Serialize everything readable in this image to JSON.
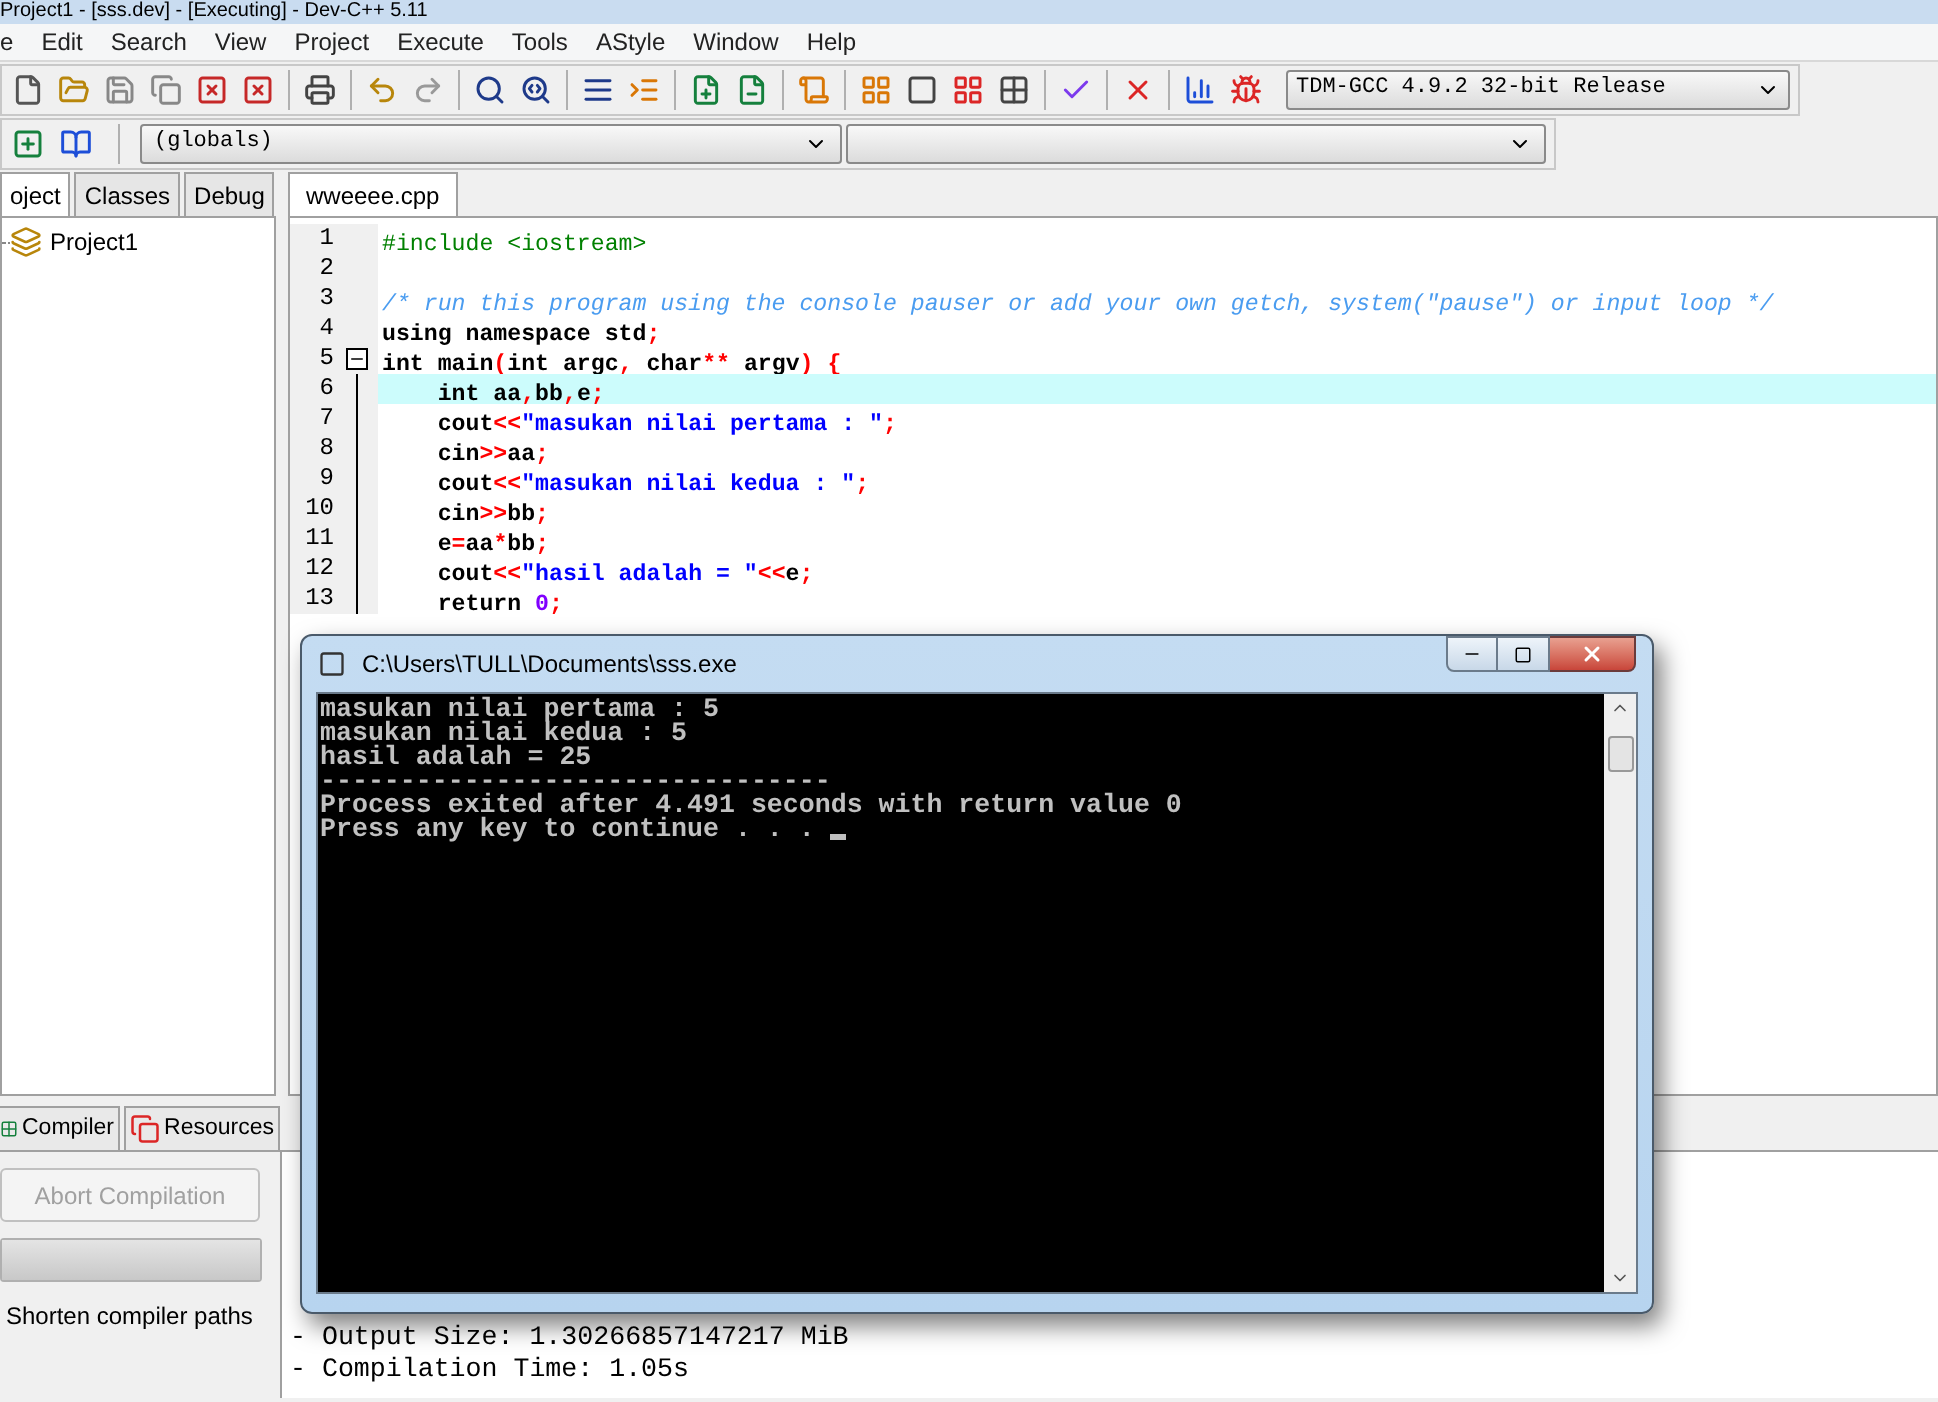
{
  "window": {
    "title": "Project1 - [sss.dev] - [Executing] - Dev-C++ 5.11"
  },
  "menu": [
    "e",
    "Edit",
    "Search",
    "View",
    "Project",
    "Execute",
    "Tools",
    "AStyle",
    "Window",
    "Help"
  ],
  "toolbar": {
    "compiler": "TDM-GCC 4.9.2 32-bit Release",
    "scope": "(globals)"
  },
  "left_tabs": [
    {
      "label": "oject",
      "selected": true
    },
    {
      "label": "Classes",
      "selected": false
    },
    {
      "label": "Debug",
      "selected": false
    }
  ],
  "project_tree": [
    {
      "label": "Project1"
    }
  ],
  "editor_tabs": [
    {
      "label": "wweeee.cpp",
      "selected": true
    }
  ],
  "code_lines": [
    {
      "number": "1",
      "current": false,
      "fold": false,
      "tokens": [
        {
          "kind": "preprocessor",
          "text": "#include <iostream>"
        }
      ]
    },
    {
      "number": "2",
      "current": false,
      "fold": false
    },
    {
      "number": "3",
      "current": false,
      "fold": false,
      "tokens": [
        {
          "kind": "comment",
          "text": "/* run this program using the console pauser or add your own getch, system(\"pause\") or input loop */"
        }
      ]
    },
    {
      "number": "4",
      "current": false,
      "fold": false,
      "tokens": [
        {
          "kind": "plain",
          "text": "using namespace std"
        },
        {
          "kind": "symbol",
          "text": ";"
        }
      ]
    },
    {
      "number": "5",
      "current": false,
      "fold": true,
      "tokens": [
        {
          "kind": "plain",
          "text": "int main"
        },
        {
          "kind": "symbol",
          "text": "("
        },
        {
          "kind": "plain",
          "text": "int argc"
        },
        {
          "kind": "symbol",
          "text": ","
        },
        {
          "kind": "plain",
          "text": " char"
        },
        {
          "kind": "symbol",
          "text": "**"
        },
        {
          "kind": "plain",
          "text": " argv"
        },
        {
          "kind": "symbol",
          "text": ") {"
        }
      ]
    },
    {
      "number": "6",
      "current": true,
      "fold": false,
      "tokens": [
        {
          "kind": "plain",
          "text": "    int aa"
        },
        {
          "kind": "symbol",
          "text": ","
        },
        {
          "kind": "plain",
          "text": "bb"
        },
        {
          "kind": "symbol",
          "text": ","
        },
        {
          "kind": "plain",
          "text": "e"
        },
        {
          "kind": "symbol",
          "text": ";"
        }
      ]
    },
    {
      "number": "7",
      "current": false,
      "fold": false,
      "tokens": [
        {
          "kind": "plain",
          "text": "    cout"
        },
        {
          "kind": "symbol",
          "text": "<<"
        },
        {
          "kind": "string",
          "text": "\"masukan nilai pertama : \""
        },
        {
          "kind": "symbol",
          "text": ";"
        }
      ]
    },
    {
      "number": "8",
      "current": false,
      "fold": false,
      "tokens": [
        {
          "kind": "plain",
          "text": "    cin"
        },
        {
          "kind": "symbol",
          "text": ">>"
        },
        {
          "kind": "plain",
          "text": "aa"
        },
        {
          "kind": "symbol",
          "text": ";"
        }
      ]
    },
    {
      "number": "9",
      "current": false,
      "fold": false,
      "tokens": [
        {
          "kind": "plain",
          "text": "    cout"
        },
        {
          "kind": "symbol",
          "text": "<<"
        },
        {
          "kind": "string",
          "text": "\"masukan nilai kedua : \""
        },
        {
          "kind": "symbol",
          "text": ";"
        }
      ]
    },
    {
      "number": "10",
      "current": false,
      "fold": false,
      "tokens": [
        {
          "kind": "plain",
          "text": "    cin"
        },
        {
          "kind": "symbol",
          "text": ">>"
        },
        {
          "kind": "plain",
          "text": "bb"
        },
        {
          "kind": "symbol",
          "text": ";"
        }
      ]
    },
    {
      "number": "11",
      "current": false,
      "fold": false,
      "tokens": [
        {
          "kind": "plain",
          "text": "    e"
        },
        {
          "kind": "symbol",
          "text": "="
        },
        {
          "kind": "plain",
          "text": "aa"
        },
        {
          "kind": "symbol",
          "text": "*"
        },
        {
          "kind": "plain",
          "text": "bb"
        },
        {
          "kind": "symbol",
          "text": ";"
        }
      ]
    },
    {
      "number": "12",
      "current": false,
      "fold": false,
      "tokens": [
        {
          "kind": "plain",
          "text": "    cout"
        },
        {
          "kind": "symbol",
          "text": "<<"
        },
        {
          "kind": "string",
          "text": "\"hasil adalah = \""
        },
        {
          "kind": "symbol",
          "text": "<<"
        },
        {
          "kind": "plain",
          "text": "e"
        },
        {
          "kind": "symbol",
          "text": ";"
        }
      ]
    },
    {
      "number": "13",
      "current": false,
      "fold": false,
      "tokens": [
        {
          "kind": "plain",
          "text": "    return "
        },
        {
          "kind": "number",
          "text": "0"
        },
        {
          "kind": "symbol",
          "text": ";"
        }
      ]
    }
  ],
  "bottom_tabs": [
    {
      "label": "Compiler",
      "selected": false
    },
    {
      "label": "Resources",
      "selected": false
    }
  ],
  "compiler_panel": {
    "abort_button": {
      "label": "Abort Compilation",
      "disabled": true
    },
    "progress": {
      "level": 1
    },
    "shorten_paths": "Shorten compiler paths"
  },
  "compile_log": [
    "- Output Size: 1.30266857147217 MiB",
    "- Compilation Time: 1.05s"
  ],
  "console": {
    "title": "C:\\Users\\TULL\\Documents\\sss.exe",
    "lines": [
      "masukan nilai pertama : 5",
      "masukan nilai kedua : 5",
      "hasil adalah = 25",
      "--------------------------------",
      "Process exited after 4.491 seconds with return value 0",
      "Press any key to continue . . . "
    ]
  }
}
